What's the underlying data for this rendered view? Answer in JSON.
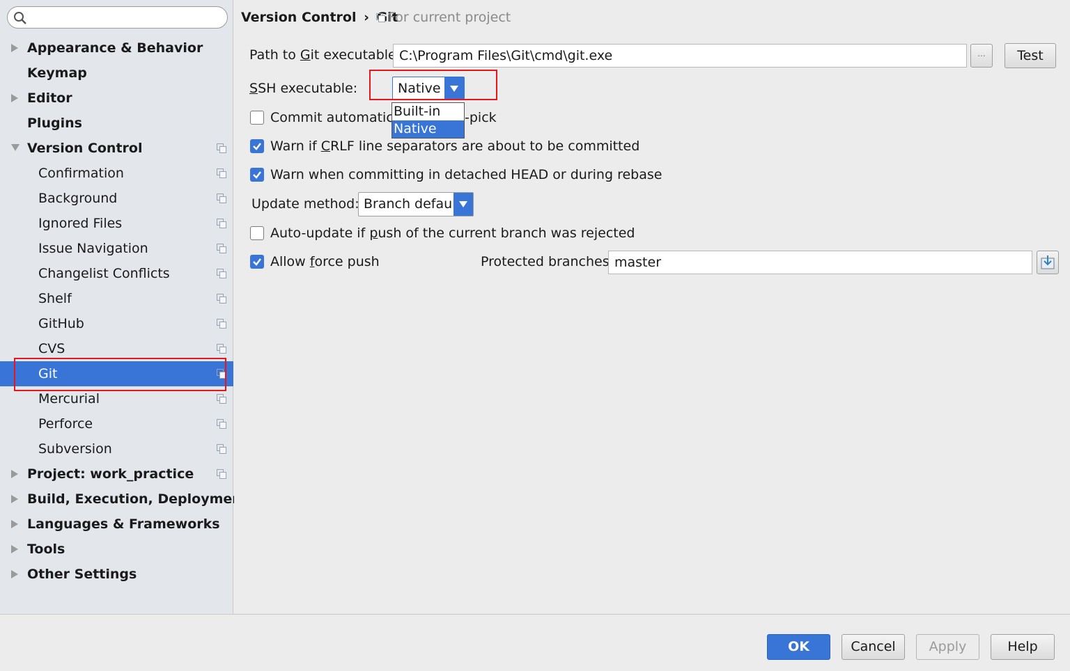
{
  "search": {
    "placeholder": "",
    "value": ""
  },
  "sidebar": {
    "items": [
      {
        "label": "Appearance & Behavior",
        "bold": true,
        "expandable": true
      },
      {
        "label": "Keymap",
        "bold": true
      },
      {
        "label": "Editor",
        "bold": true,
        "expandable": true
      },
      {
        "label": "Plugins",
        "bold": true
      },
      {
        "label": "Version Control",
        "bold": true,
        "expanded": true
      },
      {
        "label": "Confirmation"
      },
      {
        "label": "Background"
      },
      {
        "label": "Ignored Files"
      },
      {
        "label": "Issue Navigation"
      },
      {
        "label": "Changelist Conflicts"
      },
      {
        "label": "Shelf"
      },
      {
        "label": "GitHub"
      },
      {
        "label": "CVS"
      },
      {
        "label": "Git",
        "selected": true
      },
      {
        "label": "Mercurial"
      },
      {
        "label": "Perforce"
      },
      {
        "label": "Subversion"
      },
      {
        "label": "Project: work_practice",
        "bold": true,
        "expandable": true
      },
      {
        "label": "Build, Execution, Deployment",
        "bold": true,
        "expandable": true
      },
      {
        "label": "Languages & Frameworks",
        "bold": true,
        "expandable": true
      },
      {
        "label": "Tools",
        "bold": true,
        "expandable": true
      },
      {
        "label": "Other Settings",
        "bold": true,
        "expandable": true
      }
    ]
  },
  "header": {
    "crumb_parent": "Version Control",
    "crumb_sep": "›",
    "crumb_current": "Git",
    "scope_note": "For current project"
  },
  "git": {
    "path_label_pre": "Path to ",
    "path_label_u": "G",
    "path_label_post": "it executable:",
    "path_value": "C:\\Program Files\\Git\\cmd\\git.exe",
    "browse_label": "...",
    "test_label": "Test",
    "ssh_label_u": "S",
    "ssh_label_post": "SH executable:",
    "ssh_selected": "Native",
    "ssh_options": [
      "Built-in",
      "Native"
    ],
    "commit_auto_label_visible_left": "Commit automatica",
    "commit_auto_label_visible_right": "-pick",
    "commit_auto_checked": false,
    "crlf_label_pre": "Warn if ",
    "crlf_label_u": "C",
    "crlf_label_post": "RLF line separators are about to be committed",
    "crlf_checked": true,
    "detached_label": "Warn when committing in detached HEAD or during rebase",
    "detached_checked": true,
    "update_method_label": "Update method:",
    "update_method_value": "Branch default",
    "autoupdate_label_pre": "Auto-update if ",
    "autoupdate_label_u": "p",
    "autoupdate_label_post": "ush of the current branch was rejected",
    "autoupdate_checked": false,
    "force_push_label_pre": "Allow ",
    "force_push_label_u": "f",
    "force_push_label_post": "orce push",
    "force_push_checked": true,
    "protected_label": "Protected branches:",
    "protected_value": "master"
  },
  "footer": {
    "ok_label": "OK",
    "cancel_label": "Cancel",
    "apply_label": "Apply",
    "help_label": "Help"
  },
  "colors": {
    "accent": "#3875d7",
    "highlight_box": "#e8151b"
  }
}
